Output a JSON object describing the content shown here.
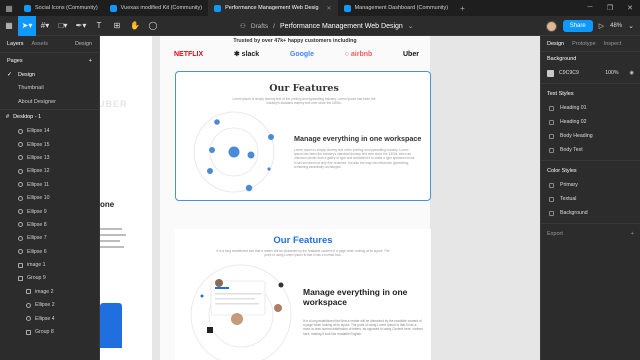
{
  "browser_tabs": [
    {
      "label": "Social Icons (Community)",
      "active": false
    },
    {
      "label": "Vuexas modified Kit (Community)",
      "active": false
    },
    {
      "label": "Performance Management Web Desig",
      "active": true
    },
    {
      "label": "Management Dashboard (Community)",
      "active": false
    }
  ],
  "breadcrumb": {
    "folder": "Drafts",
    "separator": "/",
    "file": "Performance Management Web Design"
  },
  "toolbar": {
    "share_label": "Share",
    "zoom": "48%"
  },
  "left_panel": {
    "tab_layers": "Layers",
    "tab_assets": "Assets",
    "tab_design": "Design",
    "pages_title": "Pages",
    "pages": [
      {
        "label": "Design",
        "current": true
      },
      {
        "label": "Thumbnail",
        "current": false
      },
      {
        "label": "About Designer",
        "current": false
      }
    ],
    "frame_label": "Desktop - 1",
    "layers": [
      {
        "label": "Ellipse 14",
        "kind": "ellipse",
        "indent": 1
      },
      {
        "label": "Ellipse 15",
        "kind": "ellipse",
        "indent": 1
      },
      {
        "label": "Ellipse 13",
        "kind": "ellipse",
        "indent": 1
      },
      {
        "label": "Ellipse 12",
        "kind": "ellipse",
        "indent": 1
      },
      {
        "label": "Ellipse 11",
        "kind": "ellipse",
        "indent": 1
      },
      {
        "label": "Ellipse 10",
        "kind": "ellipse",
        "indent": 1
      },
      {
        "label": "Ellipse 9",
        "kind": "ellipse",
        "indent": 1
      },
      {
        "label": "Ellipse 8",
        "kind": "ellipse",
        "indent": 1
      },
      {
        "label": "Ellipse 7",
        "kind": "ellipse",
        "indent": 1
      },
      {
        "label": "Ellipse 6",
        "kind": "ellipse",
        "indent": 1
      },
      {
        "label": "image 1",
        "kind": "image",
        "indent": 1
      },
      {
        "label": "Group 9",
        "kind": "group",
        "indent": 1
      },
      {
        "label": "image 2",
        "kind": "image",
        "indent": 2
      },
      {
        "label": "Ellipse 2",
        "kind": "ellipse",
        "indent": 2
      },
      {
        "label": "Ellipse 4",
        "kind": "ellipse",
        "indent": 2
      },
      {
        "label": "Group 8",
        "kind": "group",
        "indent": 2
      }
    ]
  },
  "canvas": {
    "left_partial_text": "UBER",
    "left_partial_heading": "one",
    "trusted_text": "Trusted by over 47k+ happy customers including",
    "logos": [
      {
        "label": "NETFLIX",
        "color": "#e50914"
      },
      {
        "label": "✱ slack",
        "color": "#222222"
      },
      {
        "label": "Google",
        "color": "#4285f4"
      },
      {
        "label": "○ airbnb",
        "color": "#ff5a5f"
      },
      {
        "label": "Uber",
        "color": "#111111"
      }
    ],
    "card": {
      "title": "Our Features",
      "subtitle": "Lorem ipsum is simply dummy text of the printing and typesetting industry. Lorem Ipsum has been the industry's standard dummy text ever since the 1500s.",
      "heading": "Manage everything in one workspace",
      "paragraph": "Lorem Ipsum is simply dummy text of the printing and typesetting industry. Lorem Ipsum has been the industry's standard dummy text ever since the 1500s, when an unknown printer took a galley of type and scrambled it to make a type specimen book. It has survived not only five centuries, but also the leap into electronic typesetting, remaining essentially unchanged."
    },
    "section2": {
      "title": "Our Features",
      "subtitle": "It is a long established fact that a reader will be distracted by the readable content of a page when looking at its layout. The point of using Lorem Ipsum is that it has a normal look.",
      "heading": "Manage everything in one workspace",
      "paragraph": "It is a long established fact that a reader will be distracted by the readable content of a page when looking at its layout. The point of using Lorem Ipsum is that it has a more-or-less normal distribution of letters, as opposed to using Content here, content here, making it look like readable English."
    },
    "help_label": "?"
  },
  "right_panel": {
    "tab_design": "Design",
    "tab_prototype": "Prototype",
    "tab_inspect": "Inspect",
    "background_title": "Background",
    "background_hex": "C9C9C9",
    "background_opacity": "100%",
    "text_styles_title": "Text Styles",
    "text_styles": [
      "Heading 01",
      "Heading 02",
      "Body Heading",
      "Body Text"
    ],
    "color_styles_title": "Color Styles",
    "color_styles": [
      "Primary",
      "Textual",
      "Background"
    ],
    "export_title": "Export"
  },
  "colors": {
    "accent": "#0d99ff",
    "brand_blue": "#1f6fe0",
    "card_border": "#4a90e2",
    "canvas_bg": "#c9c9c9"
  }
}
